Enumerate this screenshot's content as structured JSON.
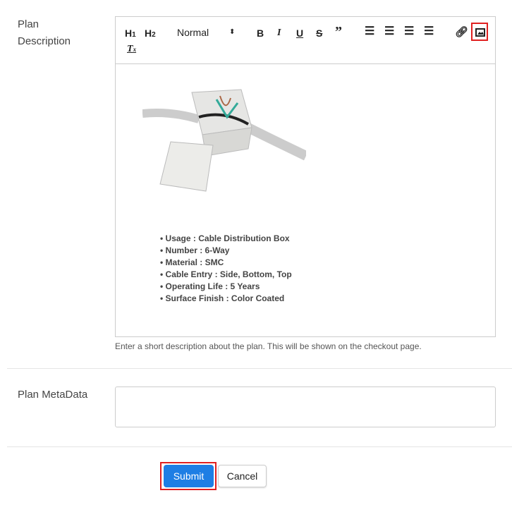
{
  "form": {
    "plan_description_label": [
      "Plan",
      "Description"
    ],
    "help_text": "Enter a short description about the plan. This will be shown on the checkout page.",
    "metadata_label": "Plan MetaData",
    "metadata_value": "",
    "submit_label": "Submit",
    "cancel_label": "Cancel"
  },
  "toolbar": {
    "h1": "H1",
    "h2": "H2",
    "format_select": "Normal",
    "icons": [
      "bold",
      "italic",
      "underline",
      "strike",
      "blockquote",
      "ordered-list",
      "bullet-list",
      "outdent",
      "indent",
      "link",
      "image",
      "clean-format"
    ],
    "highlighted": "image"
  },
  "description": {
    "specs": [
      "Usage : Cable Distribution Box",
      "Number : 6-Way",
      "Material : SMC",
      "Cable Entry : Side, Bottom, Top",
      "Operating Life : 5 Years",
      "Surface Finish : Color Coated"
    ]
  },
  "colors": {
    "primary": "#1e7ee4",
    "highlight": "#e02020"
  }
}
